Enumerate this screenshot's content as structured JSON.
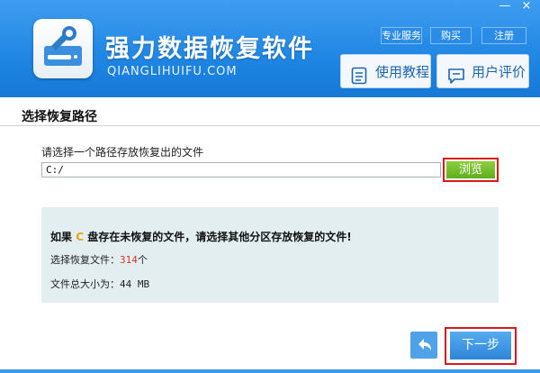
{
  "app": {
    "title": "强力数据恢复软件",
    "url": "QIANGLIHUIFU.COM"
  },
  "window_controls": {
    "minimize": "—",
    "close": "×"
  },
  "top_menu": {
    "service": "专业服务",
    "buy": "购买",
    "register": "注册"
  },
  "header_buttons": {
    "tutorial": "使用教程",
    "review": "用户评价"
  },
  "main": {
    "section_title": "选择恢复路径",
    "prompt": "请选择一个路径存放恢复出的文件",
    "path_value": "C:/",
    "browse_label": "浏览",
    "warning_prefix": "如果",
    "warning_drive": "C",
    "warning_suffix": "盘存在未恢复的文件，请选择其他分区存放恢复的文件!",
    "selected_label": "选择恢复文件：",
    "selected_count": "314",
    "selected_unit": "个",
    "size_label": "文件总大小为：",
    "size_value": "44 MB"
  },
  "footer": {
    "next_label": "下一步"
  },
  "colors": {
    "header_blue": "#1f86e3",
    "highlight_red": "#d91a1a",
    "browse_green": "#5fae1d"
  }
}
